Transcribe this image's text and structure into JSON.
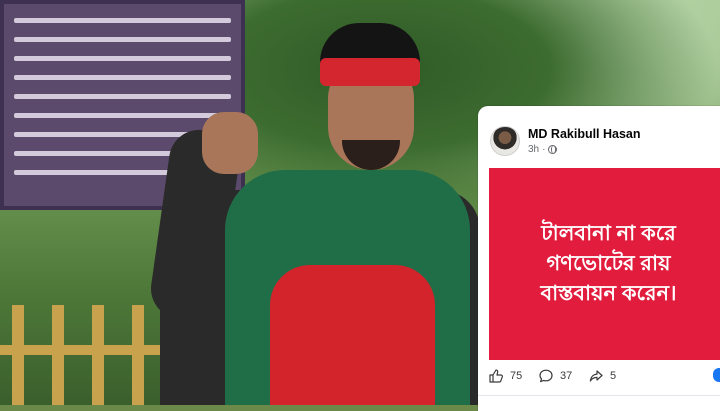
{
  "post": {
    "author": "MD Rakibull Hasan",
    "time": "3h",
    "dot": "·",
    "privacy_icon": "globe-icon",
    "background_color": "#e21c3d",
    "text_lines": [
      "টালবানা না করে",
      "গণভোটের রায়",
      "বাস্তবায়ন করেন।"
    ]
  },
  "stats": {
    "likes": "75",
    "comments": "37",
    "shares": "5",
    "like_icon": "thumbs-up-icon",
    "comment_icon": "comment-bubble-icon",
    "share_icon": "share-arrow-icon"
  },
  "colors": {
    "facebook_blue": "#1877f2",
    "text_primary": "#050505",
    "text_secondary": "#65676b"
  }
}
